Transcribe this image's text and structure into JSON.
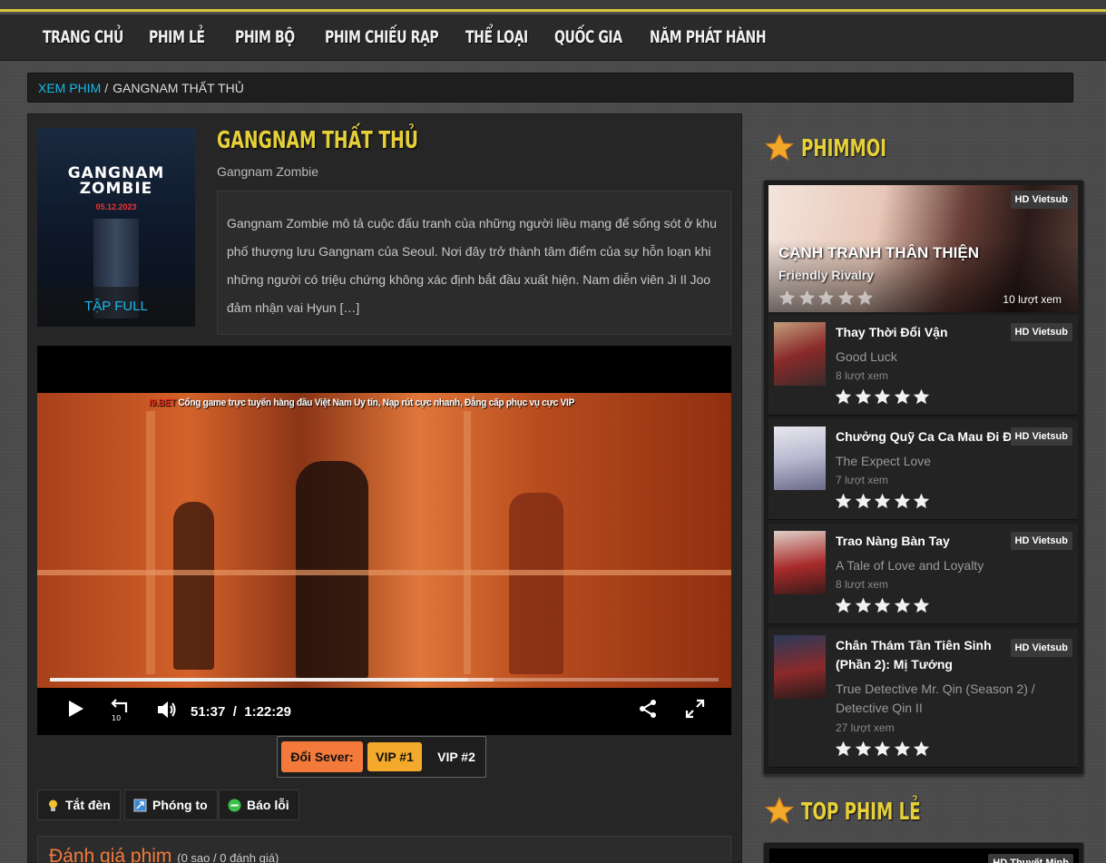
{
  "nav": {
    "items": [
      "TRANG CHỦ",
      "PHIM LẺ",
      "PHIM BỘ",
      "PHIM CHIẾU RẠP",
      "THỂ LOẠI",
      "QUỐC GIA",
      "NĂM PHÁT HÀNH"
    ]
  },
  "breadcrumb": {
    "home": "XEM PHIM",
    "separator": "/",
    "current": "GANGNAM THẤT THỦ"
  },
  "film": {
    "title": "GANGNAM THẤT THỦ",
    "original_title": "Gangnam Zombie",
    "poster_title_line1": "GANGNAM",
    "poster_title_line2": "ZOMBIE",
    "poster_date": "05.12.2023",
    "episode_label": "TẬP FULL",
    "description": "Gangnam Zombie mô tả cuộc đấu tranh của những người liều mạng để sống sót ở khu phố thượng lưu Gangnam của Seoul. Nơi đây trở thành tâm điểm của sự hỗn loạn khi những người có triệu chứng không xác định bắt đầu xuất hiện. Nam diễn viên Ji Il Joo đảm nhận vai Hyun […]"
  },
  "player": {
    "ad_brand": "I9.BET",
    "ad_text": " Cổng game trực tuyến hàng đầu Việt Nam Uy tín, Nạp rút cực nhanh, Đẳng cấp phục vụ cực VIP",
    "current_time": "51:37",
    "time_separator": "/",
    "duration": "1:22:29",
    "progress_fraction": 0.626,
    "buffered_fraction": 0.663,
    "icons": [
      "play-icon",
      "replay-10-icon",
      "volume-icon",
      "share-icon",
      "fullscreen-icon"
    ]
  },
  "server": {
    "label": "Đổi Sever:",
    "options": [
      "VIP #1",
      "VIP #2"
    ],
    "selected": "VIP #1"
  },
  "tools": {
    "lights_off": "Tắt đèn",
    "expand": "Phóng to",
    "report": "Báo lỗi"
  },
  "rating": {
    "title": "Đánh giá phim",
    "summary": "(0 sao / 0 đánh giá)"
  },
  "sidebar": {
    "section1_title": "PHIMMOI",
    "section2_title": "TOP PHIM LẺ",
    "section2_first_badge": "HD Thuyết Minh",
    "featured": {
      "title": "CẠNH TRANH THÂN THIỆN",
      "original": "Friendly Rivalry",
      "views": "10 lượt xem",
      "badge": "HD Vietsub",
      "stars": 5
    },
    "items": [
      {
        "title": "Thay Thời Đổi Vận",
        "original": "Good Luck",
        "views": "8 lượt xem",
        "badge": "HD Vietsub",
        "stars": 5
      },
      {
        "title": "Chưởng Quỹ Ca Ca Mau Đi Đi",
        "original": "The Expect Love",
        "views": "7 lượt xem",
        "badge": "HD Vietsub",
        "stars": 5
      },
      {
        "title": "Trao Nàng Bàn Tay",
        "original": "A Tale of Love and Loyalty",
        "views": "8 lượt xem",
        "badge": "HD Vietsub",
        "stars": 5
      },
      {
        "title": "Chân Thám Tần Tiên Sinh (Phần 2): Mị Tướng",
        "original": "True Detective Mr. Qin (Season 2) / Detective Qin II",
        "views": "27 lượt xem",
        "badge": "HD Vietsub",
        "stars": 5
      }
    ]
  },
  "colors": {
    "accent_yellow": "#e6d03a",
    "link_blue": "#19b8e8",
    "orange": "#f47a3b",
    "server_selected": "#f4a92a"
  }
}
